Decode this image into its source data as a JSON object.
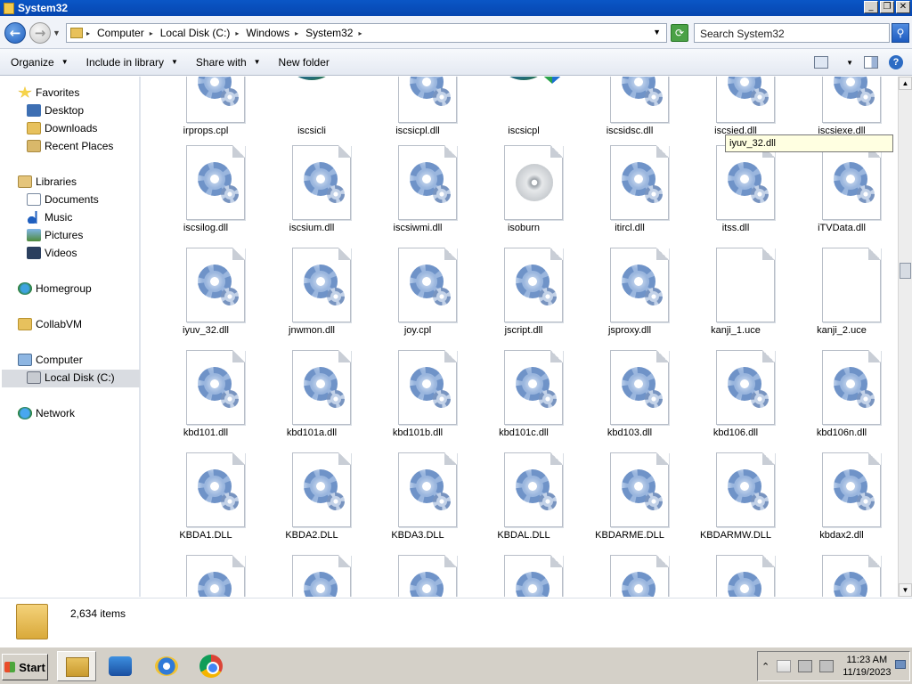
{
  "window": {
    "title": "System32"
  },
  "address": {
    "crumbs": [
      "Computer",
      "Local Disk (C:)",
      "Windows",
      "System32"
    ],
    "search_placeholder": "Search System32"
  },
  "command_bar": {
    "organize": "Organize",
    "include": "Include in library",
    "share": "Share with",
    "new_folder": "New folder"
  },
  "nav": {
    "favorites": "Favorites",
    "desktop": "Desktop",
    "downloads": "Downloads",
    "recent": "Recent Places",
    "libraries": "Libraries",
    "documents": "Documents",
    "music": "Music",
    "pictures": "Pictures",
    "videos": "Videos",
    "homegroup": "Homegroup",
    "collabvm": "CollabVM",
    "computer": "Computer",
    "local_disk": "Local Disk (C:)",
    "network": "Network"
  },
  "files": [
    [
      "irprops.cpl",
      "iscsicli",
      "iscsicpl.dll",
      "iscsicpl",
      "iscsidsc.dll",
      "iscsied.dll",
      "iscsiexe.dll"
    ],
    [
      "iscsilog.dll",
      "iscsium.dll",
      "iscsiwmi.dll",
      "isoburn",
      "itircl.dll",
      "itss.dll",
      "iTVData.dll"
    ],
    [
      "iyuv_32.dll",
      "jnwmon.dll",
      "joy.cpl",
      "jscript.dll",
      "jsproxy.dll",
      "kanji_1.uce",
      "kanji_2.uce"
    ],
    [
      "kbd101.dll",
      "kbd101a.dll",
      "kbd101b.dll",
      "kbd101c.dll",
      "kbd103.dll",
      "kbd106.dll",
      "kbd106n.dll"
    ],
    [
      "KBDA1.DLL",
      "KBDA2.DLL",
      "KBDA3.DLL",
      "KBDAL.DLL",
      "KBDARME.DLL",
      "KBDARMW.DLL",
      "kbdax2.dll"
    ]
  ],
  "tooltip": "iyuv_32.dll",
  "details": {
    "count": "2,634 items"
  },
  "taskbar": {
    "start": "Start",
    "time": "11:23 AM",
    "date": "11/19/2023"
  }
}
